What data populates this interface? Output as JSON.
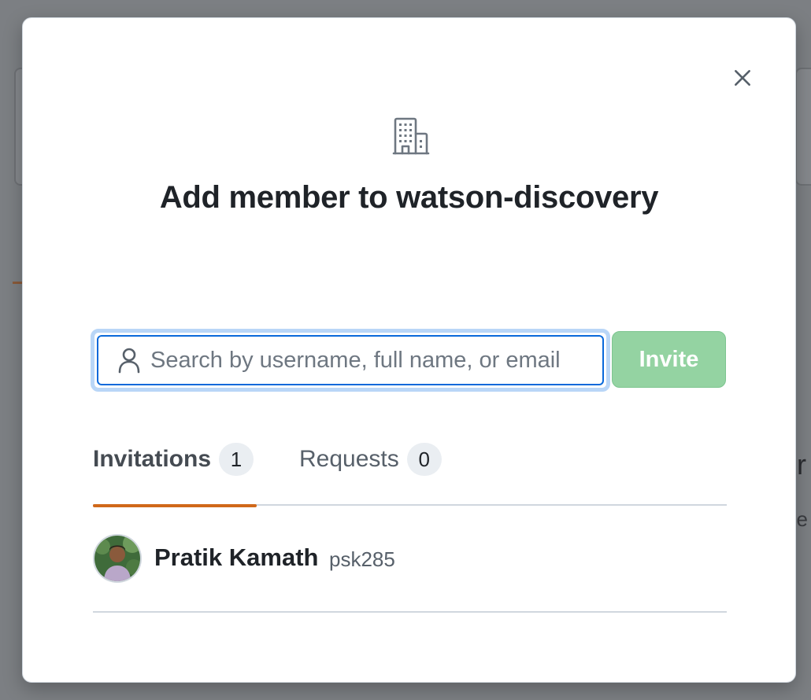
{
  "background": {
    "fragment_1": "r",
    "fragment_2": "o e"
  },
  "modal": {
    "title": "Add member to watson-discovery",
    "close_icon": "close-icon",
    "org_icon": "organization-icon"
  },
  "search": {
    "placeholder": "Search by username, full name, or email",
    "value": "",
    "icon": "person-icon"
  },
  "invite_button": {
    "label": "Invite",
    "enabled": false
  },
  "tabs": [
    {
      "label": "Invitations",
      "count": "1",
      "active": true
    },
    {
      "label": "Requests",
      "count": "0",
      "active": false
    }
  ],
  "members": [
    {
      "name": "Pratik Kamath",
      "login": "psk285"
    }
  ],
  "colors": {
    "accent_tab_underline": "#d0681a",
    "focus_border": "#0969da",
    "invite_disabled": "#94d3a2"
  }
}
